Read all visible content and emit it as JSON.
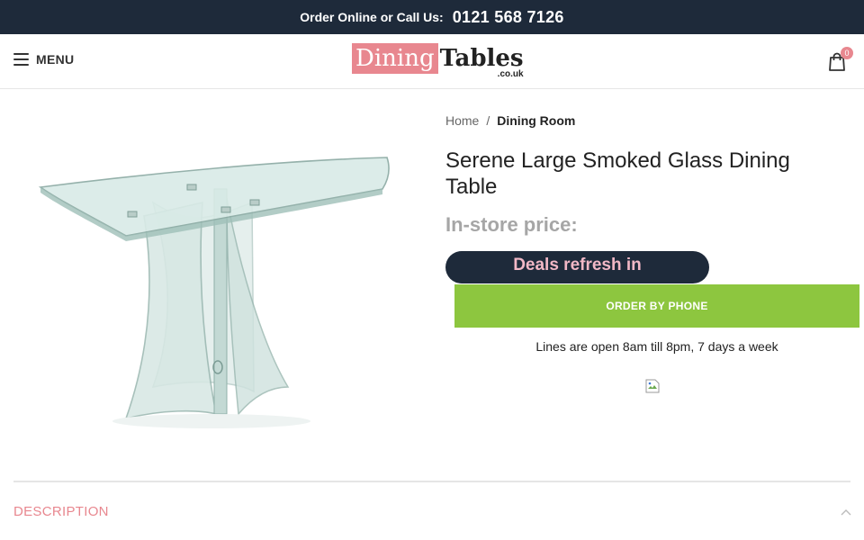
{
  "topbar": {
    "label": "Order Online or Call Us:",
    "phone": "0121 568 7126"
  },
  "header": {
    "menu_label": "MENU",
    "logo": {
      "word1": "Dining",
      "word2": "Tables",
      "suffix": ".co.uk"
    },
    "cart_count": "0"
  },
  "breadcrumb": {
    "home": "Home",
    "separator": "/",
    "current": "Dining Room"
  },
  "product": {
    "title": "Serene Large Smoked Glass Dining Table",
    "instore_price_label": "In-store price:",
    "deals_text": "Deals refresh in",
    "order_button": "ORDER BY PHONE",
    "lines_open": "Lines are open 8am till 8pm, 7 days a week"
  },
  "tabs": {
    "description": "DESCRIPTION"
  },
  "colors": {
    "navy": "#1e2a3a",
    "brand_pink": "#e8878f",
    "order_green": "#8dc63f",
    "deal_text_pink": "#f2b8c6"
  },
  "icons": [
    "hamburger-icon",
    "shopping-bag-icon",
    "broken-image-icon",
    "chevron-up-icon"
  ]
}
